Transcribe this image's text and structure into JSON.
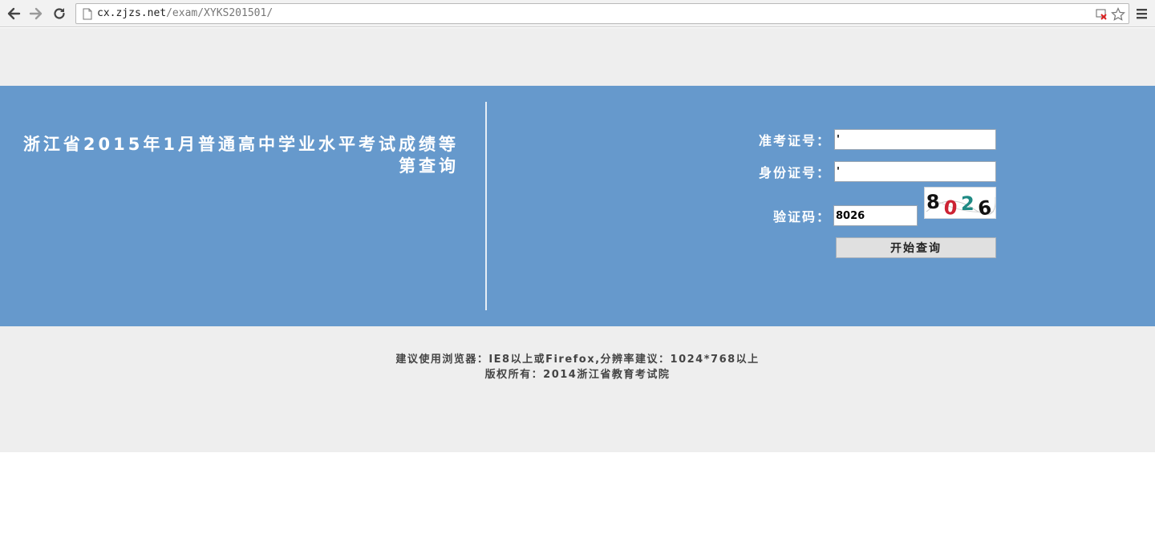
{
  "browser": {
    "url_host": "cx.zjzs.net",
    "url_path": "/exam/XYKS201501/"
  },
  "page": {
    "title": "浙江省2015年1月普通高中学业水平考试成绩等第查询"
  },
  "form": {
    "ticket_label": "准考证号：",
    "ticket_value": "'",
    "id_label": "身份证号：",
    "id_value": "'",
    "captcha_label": "验证码：",
    "captcha_value": "8026",
    "captcha_image_text": "8026",
    "submit_label": "开始查询"
  },
  "footer": {
    "browser_note": "建议使用浏览器：IE8以上或Firefox,分辨率建议：1024*768以上",
    "copyright": "版权所有：2014浙江省教育考试院"
  },
  "colors": {
    "hero_bg": "#6699cc",
    "band_bg": "#eeeeee"
  }
}
